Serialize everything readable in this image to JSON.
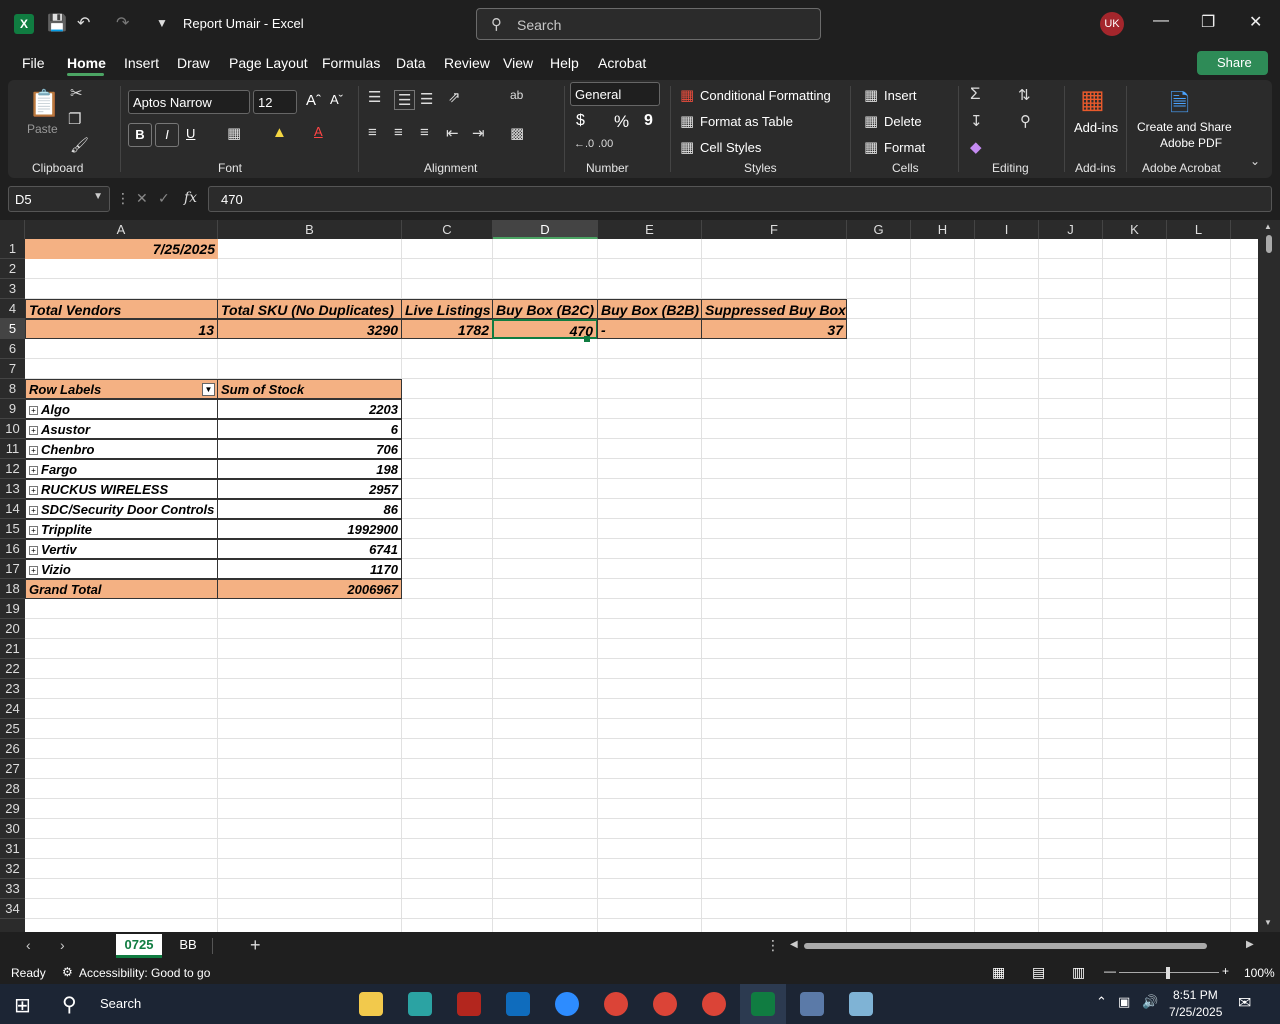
{
  "titlebar": {
    "app_icon_letter": "X",
    "title": "Report Umair  -  Excel",
    "search_placeholder": "Search",
    "avatar_initials": "UK"
  },
  "menu": {
    "tabs": [
      "File",
      "Home",
      "Insert",
      "Draw",
      "Page Layout",
      "Formulas",
      "Data",
      "Review",
      "View",
      "Help",
      "Acrobat"
    ],
    "active": "Home",
    "share_label": "Share"
  },
  "ribbon": {
    "clipboard": {
      "paste": "Paste",
      "label": "Clipboard"
    },
    "font": {
      "name": "Aptos Narrow",
      "size": "12",
      "bold": "B",
      "italic": "I",
      "underline": "U",
      "label": "Font"
    },
    "alignment": {
      "label": "Alignment"
    },
    "number": {
      "format": "General",
      "currency": "$",
      "percent": "%",
      "comma": "9",
      "label": "Number"
    },
    "styles": {
      "conditional": "Conditional Formatting",
      "format_table": "Format as Table",
      "cell_styles": "Cell Styles",
      "label": "Styles"
    },
    "cells": {
      "insert": "Insert",
      "delete": "Delete",
      "format": "Format",
      "label": "Cells"
    },
    "editing": {
      "label": "Editing"
    },
    "addins": {
      "button": "Add-ins",
      "label": "Add-ins"
    },
    "acrobat": {
      "button_line1": "Create and Share",
      "button_line2": "Adobe PDF",
      "label": "Adobe Acrobat"
    }
  },
  "formula_bar": {
    "name_box": "D5",
    "fx": "fx",
    "value": "470"
  },
  "columns": [
    "A",
    "B",
    "C",
    "D",
    "E",
    "F",
    "G",
    "H",
    "I",
    "J",
    "K",
    "L"
  ],
  "rows": [
    "1",
    "2",
    "3",
    "4",
    "5",
    "6",
    "7",
    "8",
    "9",
    "10",
    "11",
    "12",
    "13",
    "14",
    "15",
    "16",
    "17",
    "18",
    "19",
    "20",
    "21",
    "22",
    "23",
    "24",
    "25",
    "26",
    "27",
    "28",
    "29",
    "30",
    "31",
    "32",
    "33",
    "34"
  ],
  "cells": {
    "A1": "7/25/2025",
    "headers": [
      "Total Vendors",
      "Total SKU (No Duplicates)",
      "Live Listings",
      "Buy Box (B2C)",
      "Buy Box (B2B)",
      "Suppressed Buy Box"
    ],
    "values": [
      "13",
      "3290",
      "1782",
      "470",
      "-",
      "37"
    ]
  },
  "pivot": {
    "header_labels": "Row Labels",
    "header_sum": "Sum of Stock",
    "rows": [
      {
        "label": "Algo",
        "value": "2203"
      },
      {
        "label": "Asustor",
        "value": "6"
      },
      {
        "label": "Chenbro",
        "value": "706"
      },
      {
        "label": "Fargo",
        "value": "198"
      },
      {
        "label": "RUCKUS WIRELESS",
        "value": "2957"
      },
      {
        "label": "SDC/Security Door Controls",
        "value": "86"
      },
      {
        "label": "Tripplite",
        "value": "1992900"
      },
      {
        "label": "Vertiv",
        "value": "6741"
      },
      {
        "label": "Vizio",
        "value": "1170"
      }
    ],
    "grand_total_label": "Grand Total",
    "grand_total_value": "2006967"
  },
  "sheets": {
    "tabs": [
      "0725",
      "BB"
    ],
    "active": "0725"
  },
  "status": {
    "ready": "Ready",
    "accessibility": "Accessibility: Good to go",
    "zoom": "100%"
  },
  "taskbar": {
    "search": "Search",
    "time": "8:51 PM",
    "date": "7/25/2025"
  },
  "colors": {
    "accent": "#107c41",
    "header_fill": "#f4b183"
  }
}
